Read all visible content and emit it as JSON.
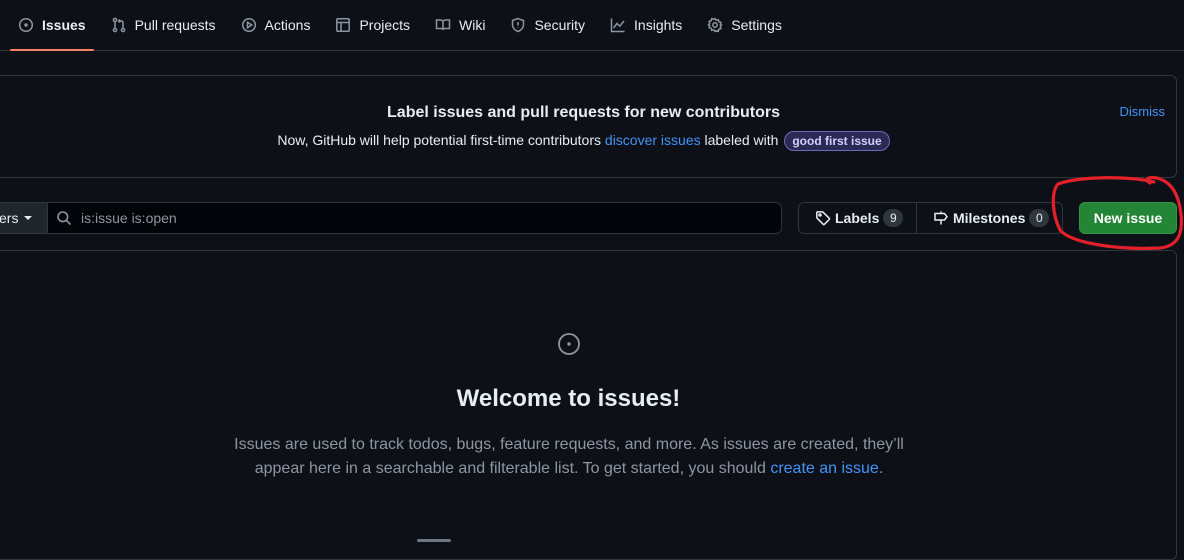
{
  "nav": {
    "tabs": [
      {
        "label": "Issues",
        "icon": "issue-opened-icon",
        "selected": true
      },
      {
        "label": "Pull requests",
        "icon": "git-pull-request-icon"
      },
      {
        "label": "Actions",
        "icon": "play-icon"
      },
      {
        "label": "Projects",
        "icon": "table-icon"
      },
      {
        "label": "Wiki",
        "icon": "book-icon"
      },
      {
        "label": "Security",
        "icon": "shield-icon"
      },
      {
        "label": "Insights",
        "icon": "graph-icon"
      },
      {
        "label": "Settings",
        "icon": "gear-icon"
      }
    ]
  },
  "banner": {
    "title": "Label issues and pull requests for new contributors",
    "desc_prefix": "Now, GitHub will help potential first-time contributors ",
    "desc_link": "discover issues",
    "desc_mid": " labeled with ",
    "label": "good first issue",
    "dismiss": "Dismiss"
  },
  "filters": {
    "button_label": "ers",
    "search_value": "is:issue is:open"
  },
  "labels_button": {
    "label": "Labels",
    "count": "9"
  },
  "milestones_button": {
    "label": "Milestones",
    "count": "0"
  },
  "new_issue": {
    "label": "New issue"
  },
  "colors": {
    "background": "#0d1117",
    "accent_link": "#4493f8",
    "primary_button": "#238636",
    "selected_tab_underline": "#f78166",
    "annotation_red": "#e5202a"
  },
  "blankslate": {
    "title": "Welcome to issues!",
    "desc_prefix": "Issues are used to track todos, bugs, feature requests, and more. As issues are created, they’ll appear here in a searchable and filterable list. To get started, you should ",
    "desc_link": "create an issue",
    "desc_suffix": "."
  }
}
